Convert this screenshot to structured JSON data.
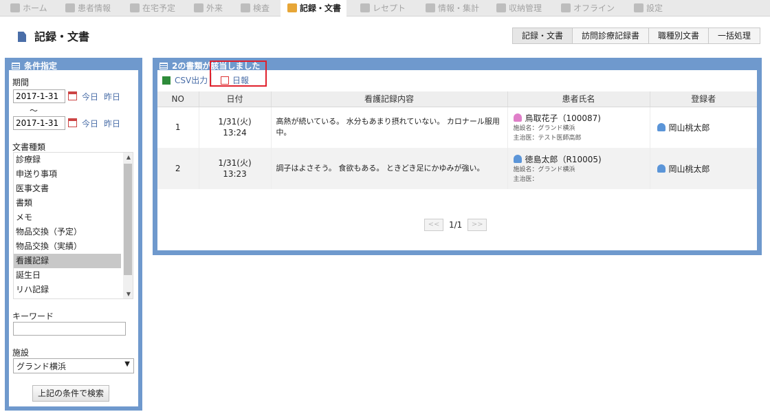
{
  "nav": {
    "items": [
      {
        "label": "ホーム"
      },
      {
        "label": "患者情報"
      },
      {
        "label": "在宅予定"
      },
      {
        "label": "外来"
      },
      {
        "label": "検査"
      },
      {
        "label": "記録・文書"
      },
      {
        "label": "レセプト"
      },
      {
        "label": "情報・集計"
      },
      {
        "label": "収納管理"
      },
      {
        "label": "オフライン"
      },
      {
        "label": "設定"
      }
    ],
    "active": "記録・文書"
  },
  "header": {
    "title": "記録・文書",
    "tabs": [
      "記録・文書",
      "訪問診療記録書",
      "職種別文書",
      "一括処理"
    ]
  },
  "conditions": {
    "title": "条件指定",
    "period_label": "期間",
    "date_from": "2017-1-31",
    "date_to": "2017-1-31",
    "today": "今日",
    "yesterday": "昨日",
    "tilde": "～",
    "doc_type_label": "文書種類",
    "doc_types": [
      "診療録",
      "申送り事項",
      "医事文書",
      "書類",
      "メモ",
      "物品交換（予定）",
      "物品交換（実績）",
      "看護記録",
      "誕生日",
      "リハ記録"
    ],
    "selected_doc_type": "看護記録",
    "keyword_label": "キーワード",
    "keyword": "",
    "facility_label": "施設",
    "facility": "グランド横浜",
    "search_button": "上記の条件で検索"
  },
  "results": {
    "title": "2の書類が該当しました",
    "csv_button": "CSV出力",
    "daily_button": "日報",
    "columns": [
      "NO",
      "日付",
      "看護記録内容",
      "患者氏名",
      "登録者"
    ],
    "rows": [
      {
        "no": "1",
        "date": "1/31(火)",
        "time": "13:24",
        "content": "高熱が続いている。 水分もあまり摂れていない。 カロナール服用中。",
        "patient": "鳥取花子（100087)",
        "facility": "施設名：グランド横浜",
        "doctor": "主治医：テスト医師高郎",
        "registrant": "岡山桃太郎"
      },
      {
        "no": "2",
        "date": "1/31(火)",
        "time": "13:23",
        "content": "調子はよさそう。 食欲もある。 ときどき足にかゆみが強い。",
        "patient": "徳島太郎（R10005)",
        "facility": "施設名：グランド横浜",
        "doctor": "主治医：",
        "registrant": "岡山桃太郎"
      }
    ],
    "pager": {
      "prev": "<<",
      "info": "1/1",
      "next": ">>"
    }
  }
}
